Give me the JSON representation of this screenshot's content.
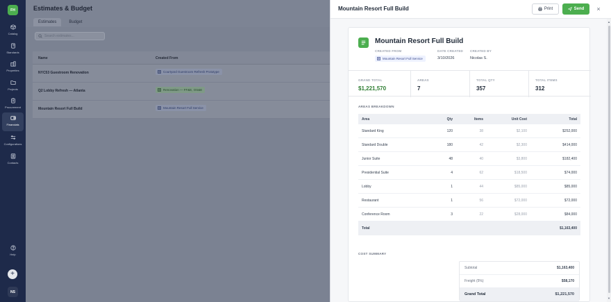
{
  "sidebar": {
    "logo": "FH",
    "items": [
      {
        "label": "Catalog",
        "icon": "cube-icon"
      },
      {
        "label": "Standards",
        "icon": "book-icon"
      },
      {
        "label": "Properties",
        "icon": "building-icon"
      },
      {
        "label": "Projects",
        "icon": "folder-icon"
      },
      {
        "label": "Procurement",
        "icon": "clipboard-icon"
      },
      {
        "label": "Financials",
        "icon": "wallet-icon"
      },
      {
        "label": "Configurations",
        "icon": "sliders-icon"
      },
      {
        "label": "Contacts",
        "icon": "contacts-icon"
      }
    ],
    "help": "Help",
    "add": "+",
    "user_initials": "NS"
  },
  "page": {
    "title": "Estimates & Budget",
    "tabs": [
      "Estimates",
      "Budget"
    ],
    "search_placeholder": "Search estimates...",
    "columns": {
      "name": "Name",
      "created_from": "Created From"
    },
    "rows": [
      {
        "name": "NYC53 Guestroom Renovation",
        "created_from": "Courtyard Guestroom Refresh Prototype"
      },
      {
        "name": "Q2 Lobby Refresh — Atlanta",
        "created_from": "Renovation — FF&E, OS&E"
      },
      {
        "name": "Mountain Resort Full Build",
        "created_from": "Mountain Resort Full Service"
      }
    ]
  },
  "panel": {
    "header_title": "Mountain Resort Full Build",
    "print_label": "Print",
    "send_label": "Send",
    "close": "×",
    "title": "Mountain Resort Full Build",
    "meta": {
      "created_from_label": "CREATED FROM",
      "created_from": "Mountain Resort Full Service",
      "date_created_label": "DATE CREATED",
      "date_created": "3/10/2026",
      "created_by_label": "CREATED BY",
      "created_by": "Nicolas S."
    },
    "stats": [
      {
        "label": "GRAND TOTAL",
        "value": "$1,221,570"
      },
      {
        "label": "AREAS",
        "value": "7"
      },
      {
        "label": "TOTAL QTY",
        "value": "357"
      },
      {
        "label": "TOTAL ITEMS",
        "value": "312"
      }
    ],
    "areas_title": "AREAS BREAKDOWN",
    "areas_columns": {
      "area": "Area",
      "qty": "Qty",
      "items": "Items",
      "unit_cost": "Unit Cost",
      "total": "Total"
    },
    "areas": [
      {
        "area": "Standard King",
        "qty": "120",
        "items": "38",
        "unit_cost": "$2,100",
        "total": "$252,000"
      },
      {
        "area": "Standard Double",
        "qty": "180",
        "items": "42",
        "unit_cost": "$2,300",
        "total": "$414,000"
      },
      {
        "area": "Junior Suite",
        "qty": "48",
        "items": "40",
        "unit_cost": "$3,800",
        "total": "$182,400"
      },
      {
        "area": "Presidential Suite",
        "qty": "4",
        "items": "62",
        "unit_cost": "$18,500",
        "total": "$74,000"
      },
      {
        "area": "Lobby",
        "qty": "1",
        "items": "44",
        "unit_cost": "$85,000",
        "total": "$85,000"
      },
      {
        "area": "Restaurant",
        "qty": "1",
        "items": "56",
        "unit_cost": "$72,000",
        "total": "$72,000"
      },
      {
        "area": "Conference Room",
        "qty": "3",
        "items": "22",
        "unit_cost": "$28,000",
        "total": "$84,000"
      }
    ],
    "areas_total_label": "Total",
    "areas_total": "$1,163,400",
    "cost_title": "COST SUMMARY",
    "cost": [
      {
        "label": "Subtotal",
        "value": "$1,163,400"
      },
      {
        "label": "Freight (5%)",
        "value": "$58,170"
      },
      {
        "label": "Grand Total",
        "value": "$1,221,570"
      }
    ]
  },
  "colors": {
    "brand_green": "#4cae4f",
    "sidebar": "#1e2a4a"
  }
}
